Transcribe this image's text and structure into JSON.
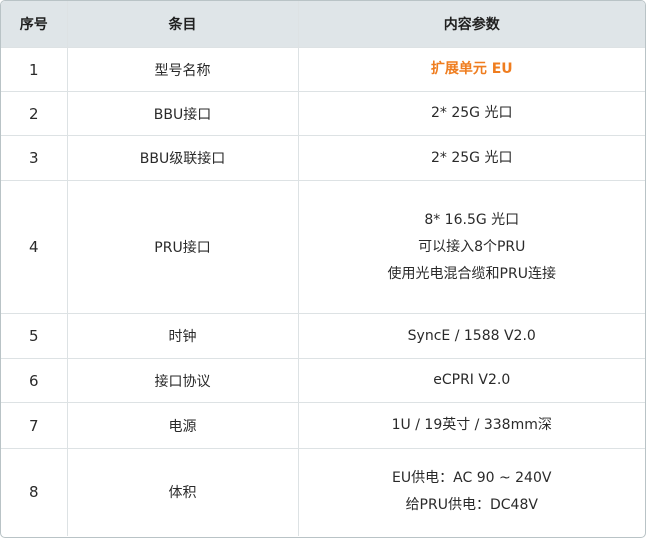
{
  "table": {
    "headers": [
      "序号",
      "条目",
      "内容参数"
    ],
    "rows": [
      {
        "index": "1",
        "item": "型号名称",
        "values": [
          "扩展单元 EU"
        ]
      },
      {
        "index": "2",
        "item": "BBU接口",
        "values": [
          "2* 25G 光口"
        ]
      },
      {
        "index": "3",
        "item": "BBU级联接口",
        "values": [
          "2* 25G 光口"
        ]
      },
      {
        "index": "4",
        "item": "PRU接口",
        "values": [
          "8* 16.5G 光口",
          "可以接入8个PRU",
          "使用光电混合缆和PRU连接"
        ]
      },
      {
        "index": "5",
        "item": "时钟",
        "values": [
          "SyncE / 1588 V2.0"
        ]
      },
      {
        "index": "6",
        "item": "接口协议",
        "values": [
          "eCPRI V2.0"
        ]
      },
      {
        "index": "7",
        "item": "电源",
        "values": [
          "1U / 19英寸 / 338mm深"
        ]
      },
      {
        "index": "8",
        "item": "体积",
        "values": [
          "EU供电：AC 90 ~ 240V",
          "给PRU供电：DC48V"
        ]
      }
    ]
  },
  "colors": {
    "header_bg": "#dfe5e8",
    "highlight": "#ef7d1f",
    "border": "#dde2e4"
  }
}
